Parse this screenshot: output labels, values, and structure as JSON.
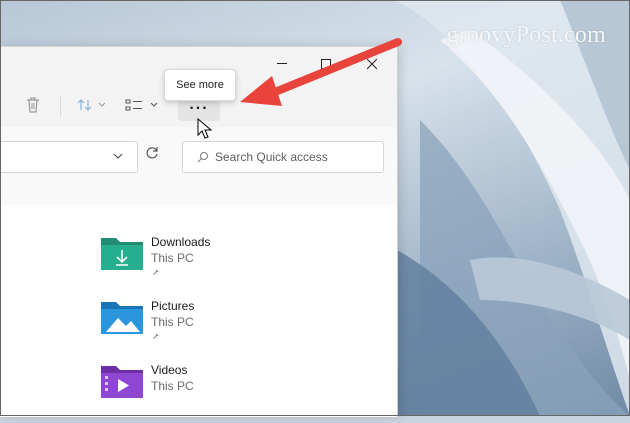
{
  "watermark": "groovyPost.com",
  "window": {
    "toolbar": {
      "delete_icon": "trash-icon",
      "sort_icon": "sort-icon",
      "view_icon": "view-options-icon",
      "see_more_icon": "ellipsis-icon",
      "see_more_label": "..."
    },
    "tooltip": "See more",
    "search": {
      "placeholder": "Search Quick access",
      "icon": "search-icon"
    },
    "items": [
      {
        "name": "Downloads",
        "location": "This PC",
        "icon": "downloads-folder-icon",
        "color": "#1a9f83"
      },
      {
        "name": "Pictures",
        "location": "This PC",
        "icon": "pictures-folder-icon",
        "color": "#1d8fd6"
      },
      {
        "name": "Videos",
        "location": "This PC",
        "icon": "videos-folder-icon",
        "color": "#8b3fc9"
      }
    ]
  },
  "colors": {
    "accent_arrow": "#e8443b",
    "command_bar": "#f3f3f3"
  }
}
